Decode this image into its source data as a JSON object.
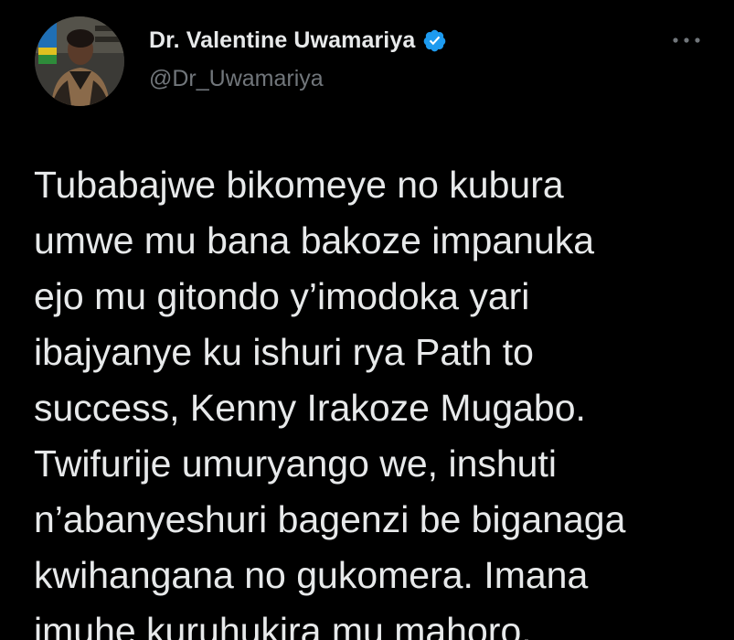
{
  "author": {
    "display_name": "Dr. Valentine Uwamariya",
    "handle": "@Dr_Uwamariya",
    "verified": true,
    "verified_icon": "verified-badge-icon",
    "avatar_icon": "avatar-photo"
  },
  "menu": {
    "icon": "more-options-icon"
  },
  "tweet": {
    "lines": [
      "Tubabajwe bikomeye no kubura",
      "umwe mu bana bakoze impanuka",
      "ejo mu gitondo y’imodoka yari",
      "ibajyanye ku ishuri rya Path to",
      "success, Kenny Irakoze Mugabo.",
      "Twifurije umuryango we, inshuti",
      "n’abanyeshuri bagenzi be biganaga",
      "kwihangana no gukomera. Imana",
      "imuhe kuruhukira mu mahoro."
    ]
  },
  "colors": {
    "background": "#000000",
    "text_primary": "#e7e9ea",
    "text_secondary": "#71767b",
    "verified_blue": "#1d9bf0"
  }
}
